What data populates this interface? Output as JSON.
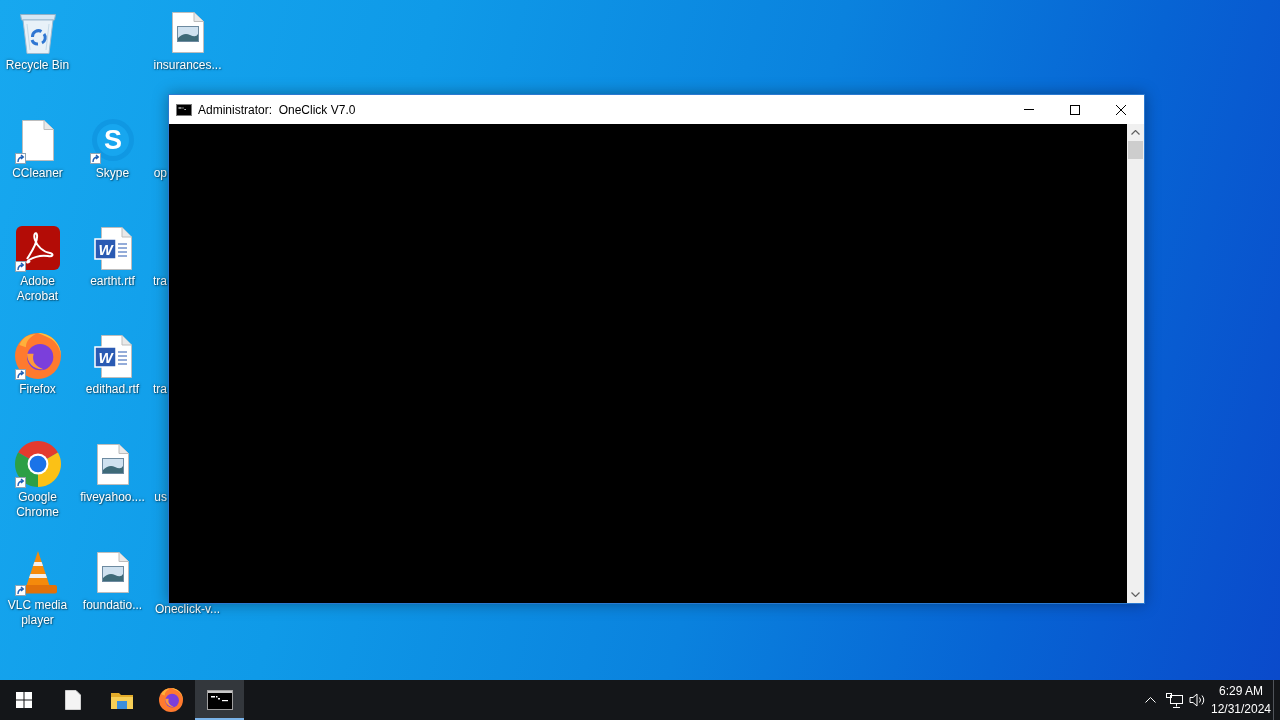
{
  "desktop": {
    "columns": [
      {
        "icons": [
          {
            "kind": "recycle_bin",
            "label": "Recycle Bin",
            "shortcut": false
          },
          {
            "kind": "blank_file",
            "label": "CCleaner",
            "shortcut": true
          },
          {
            "kind": "acrobat",
            "label": "Adobe Acrobat",
            "shortcut": true
          },
          {
            "kind": "firefox",
            "label": "Firefox",
            "shortcut": true
          },
          {
            "kind": "chrome",
            "label": "Google Chrome",
            "shortcut": true
          },
          {
            "kind": "vlc",
            "label": "VLC media player",
            "shortcut": true
          }
        ]
      },
      {
        "icons": [
          {
            "kind": "skype",
            "glyph": "S",
            "label": "Skype",
            "shortcut": true
          },
          {
            "kind": "word",
            "glyph": "W",
            "label": "eartht.rtf",
            "shortcut": false
          },
          {
            "kind": "word",
            "glyph": "W",
            "label": "edithad.rtf",
            "shortcut": false
          },
          {
            "kind": "image_file",
            "label": "fiveyahoo....",
            "shortcut": false
          },
          {
            "kind": "image_file",
            "label": "foundatio...",
            "shortcut": false
          }
        ]
      },
      {
        "icons": [
          {
            "kind": "image_file",
            "label": "insurances...",
            "shortcut": false
          },
          {
            "kind": "covered",
            "label": "op"
          },
          {
            "kind": "covered",
            "label": "tra"
          },
          {
            "kind": "covered",
            "label": "tra"
          },
          {
            "kind": "covered",
            "label": "us"
          },
          {
            "kind": "label_only",
            "label": "Oneclick-v..."
          }
        ]
      }
    ]
  },
  "window": {
    "title": "Administrator:  OneClick V7.0"
  },
  "taskbar": {
    "apps": [
      {
        "kind": "file",
        "selected": false
      },
      {
        "kind": "folder",
        "selected": false
      },
      {
        "kind": "firefox",
        "selected": false
      },
      {
        "kind": "console",
        "selected": true
      }
    ],
    "clock": {
      "time": "6:29 AM",
      "date": "12/31/2024"
    }
  }
}
